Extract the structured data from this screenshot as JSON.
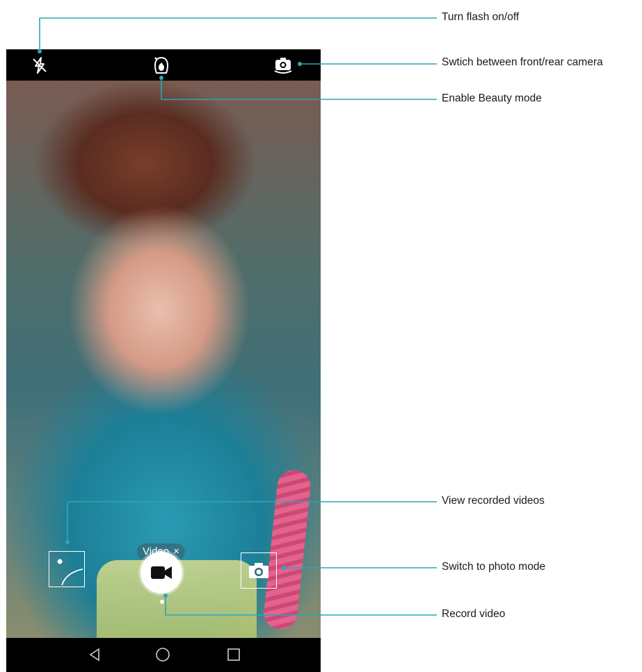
{
  "camera": {
    "mode_label": "Video",
    "mode_close_glyph": "×"
  },
  "icons": {
    "flash": "flash-off-icon",
    "beauty": "beauty-mode-icon",
    "switch_camera": "switch-camera-icon",
    "gallery": "recorded-videos-thumbnail",
    "record": "video-camera-icon",
    "photo": "photo-camera-icon",
    "nav_back": "back-triangle-icon",
    "nav_home": "home-circle-icon",
    "nav_recents": "recents-square-icon"
  },
  "callouts": [
    {
      "label": "Turn flash on/off"
    },
    {
      "label": "Swtich between front/rear camera"
    },
    {
      "label": "Enable Beauty mode"
    },
    {
      "label": "View recorded videos"
    },
    {
      "label": "Switch to photo mode"
    },
    {
      "label": "Record video"
    }
  ],
  "colors": {
    "callout_line": "#2aa7b3",
    "record_button": "#ffffff",
    "bars": "#000000"
  }
}
